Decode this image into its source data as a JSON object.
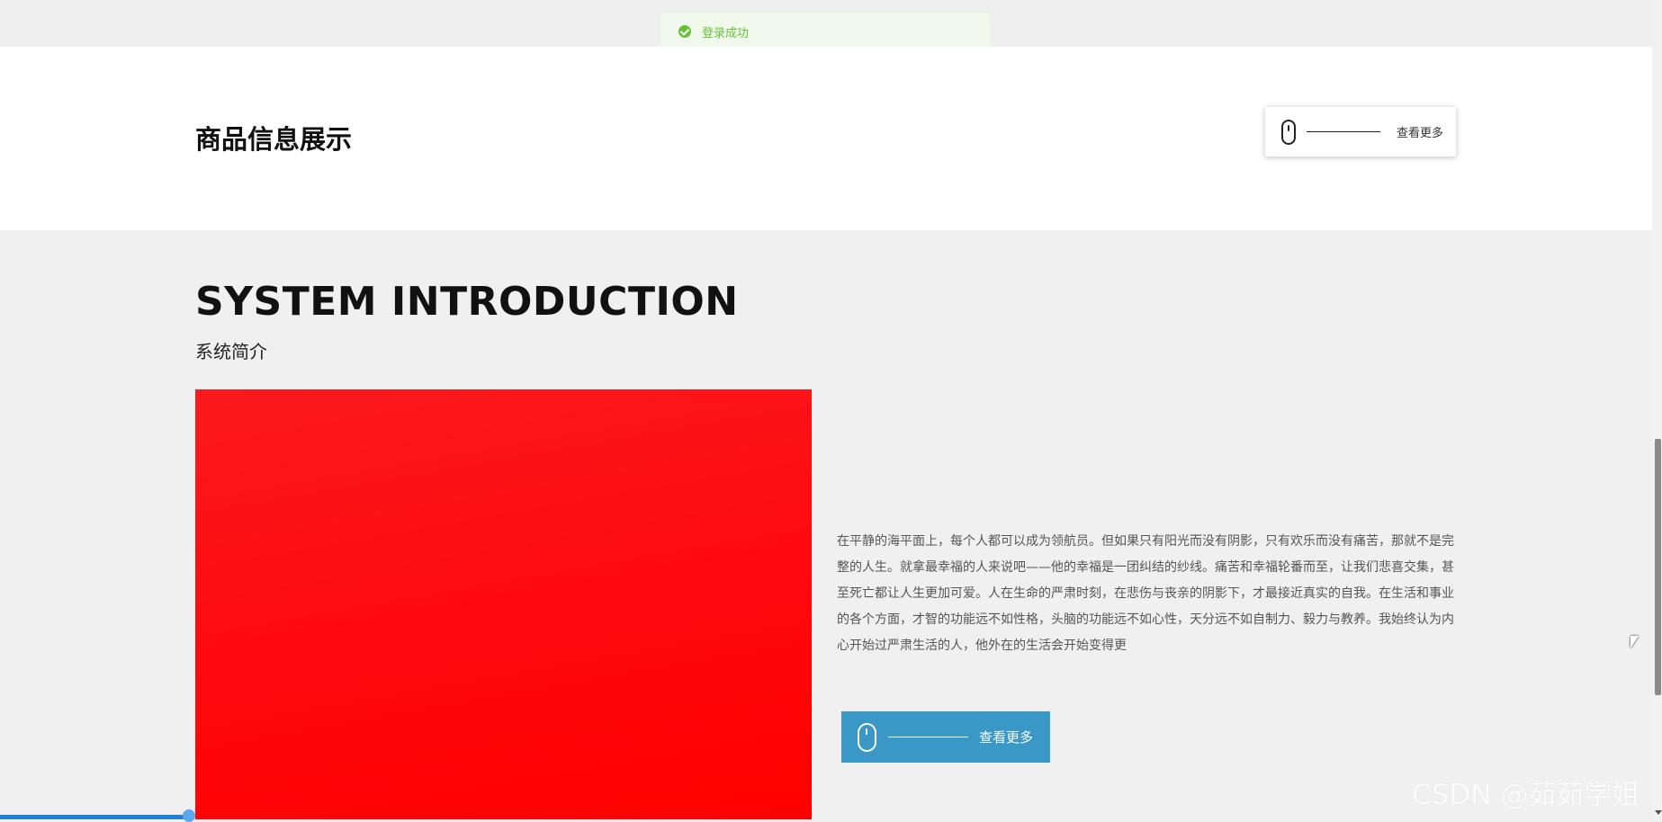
{
  "toast": {
    "message": "登录成功",
    "icon": "success-check-icon",
    "color": "#67c23a"
  },
  "products": {
    "title": "商品信息展示",
    "more_label": "查看更多"
  },
  "intro": {
    "title": "SYSTEM INTRODUCTION",
    "subtitle": "系统简介",
    "image_color": "#ff0000",
    "paragraph": "在平静的海平面上，每个人都可以成为领航员。但如果只有阳光而没有阴影，只有欢乐而没有痛苦，那就不是完整的人生。就拿最幸福的人来说吧——他的幸福是一团纠结的纱线。痛苦和幸福轮番而至，让我们悲喜交集，甚至死亡都让人生更加可爱。人在生命的严肃时刻，在悲伤与丧亲的阴影下，才最接近真实的自我。在生活和事业的各个方面，才智的功能远不如性格，头脑的功能远不如心性，天分远不如自制力、毅力与教养。我始终认为内心开始过严肃生活的人，他外在的生活会开始变得更",
    "more_label": "查看更多",
    "button_color": "#3a98c7"
  },
  "watermark": "CSDN @茹茹学姐"
}
